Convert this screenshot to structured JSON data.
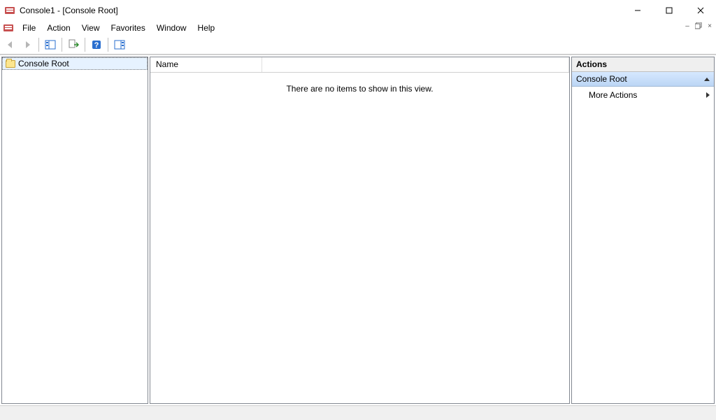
{
  "window": {
    "title": "Console1 - [Console Root]"
  },
  "menu": {
    "file": "File",
    "action": "Action",
    "view": "View",
    "favorites": "Favorites",
    "window": "Window",
    "help": "Help"
  },
  "tree": {
    "root_label": "Console Root"
  },
  "list": {
    "columns": {
      "name": "Name"
    },
    "empty_message": "There are no items to show in this view."
  },
  "actions": {
    "header": "Actions",
    "section": "Console Root",
    "more_actions": "More Actions"
  },
  "icons": {
    "back": "back-arrow",
    "forward": "forward-arrow",
    "show_hide": "toggle-tree",
    "export": "export-list",
    "help": "help",
    "pane": "action-pane"
  }
}
